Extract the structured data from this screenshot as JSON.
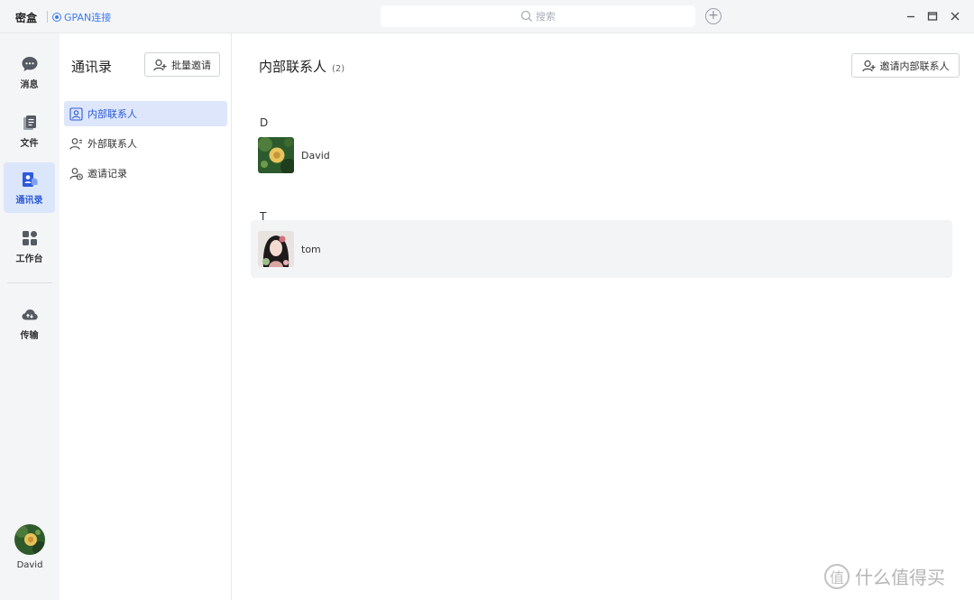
{
  "titlebar": {
    "app_name": "密盒",
    "connection_label": "GPAN连接",
    "search_placeholder": "搜索"
  },
  "nav": {
    "items": [
      {
        "label": "消息",
        "icon": "chat-icon"
      },
      {
        "label": "文件",
        "icon": "file-icon"
      },
      {
        "label": "通讯录",
        "icon": "contacts-icon"
      },
      {
        "label": "工作台",
        "icon": "workbench-icon"
      },
      {
        "label": "传输",
        "icon": "cloud-transfer-icon"
      }
    ],
    "active_index": 2,
    "user_name": "David"
  },
  "contacts_panel": {
    "title": "通讯录",
    "batch_invite_label": "批量邀请",
    "items": [
      {
        "label": "内部联系人",
        "icon": "internal-contact-icon"
      },
      {
        "label": "外部联系人",
        "icon": "external-contact-icon"
      },
      {
        "label": "邀请记录",
        "icon": "invite-record-icon"
      }
    ],
    "active_index": 0
  },
  "main": {
    "title": "内部联系人",
    "count": "(2)",
    "invite_button_label": "邀请内部联系人",
    "groups": [
      {
        "letter": "D",
        "contacts": [
          {
            "name": "David"
          }
        ]
      },
      {
        "letter": "T",
        "contacts": [
          {
            "name": "tom"
          }
        ]
      }
    ]
  },
  "watermark": {
    "logo_char": "值",
    "text": "什么值得买"
  },
  "colors": {
    "accent": "#2e5bd8",
    "link": "#3b7bf0",
    "active_bg": "#dde6fb",
    "sidebar_bg": "#f4f5f7"
  }
}
